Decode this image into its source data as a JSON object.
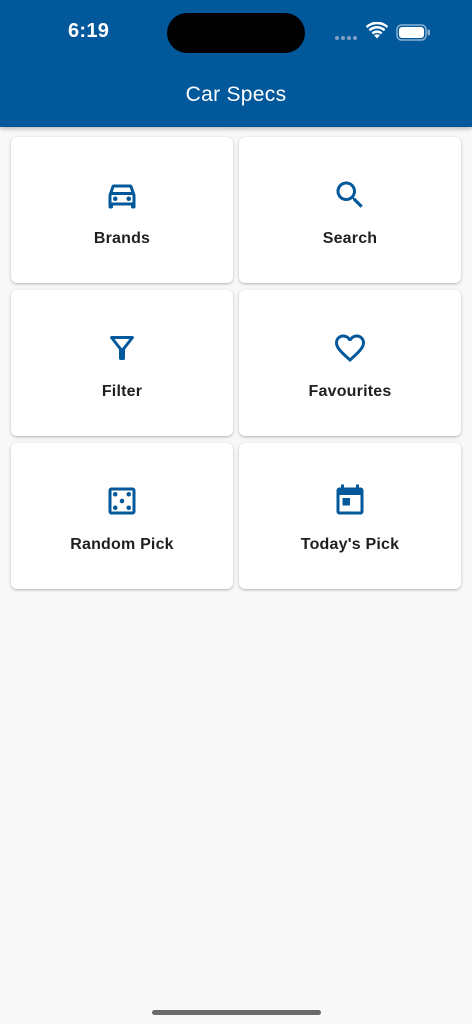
{
  "status_bar": {
    "time": "6:19"
  },
  "app_bar": {
    "title": "Car Specs",
    "color": "#01589b"
  },
  "menu": {
    "icon_color": "#01589b",
    "items": [
      {
        "label": "Brands",
        "icon": "car-icon"
      },
      {
        "label": "Search",
        "icon": "search-icon"
      },
      {
        "label": "Filter",
        "icon": "filter-icon"
      },
      {
        "label": "Favourites",
        "icon": "heart-icon"
      },
      {
        "label": "Random Pick",
        "icon": "dice-icon"
      },
      {
        "label": "Today's Pick",
        "icon": "calendar-icon"
      }
    ]
  }
}
